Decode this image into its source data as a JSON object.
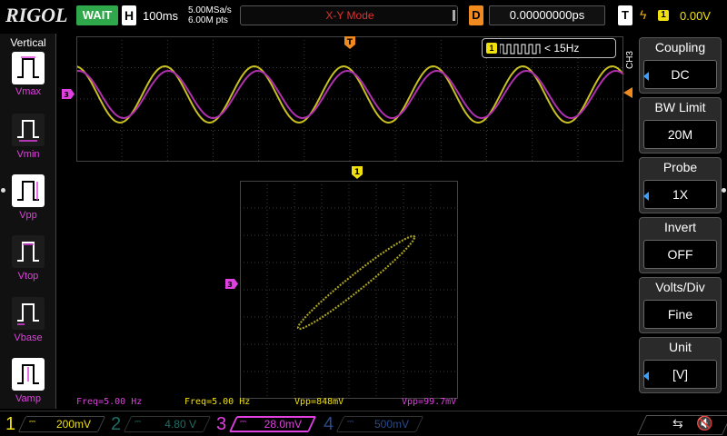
{
  "topbar": {
    "brand": "RIGOL",
    "run_status": "WAIT",
    "horizontal_label": "H",
    "timebase": "100ms",
    "sample_rate": "5.00MSa/s",
    "memory_depth": "6.00M pts",
    "mode_title": "X-Y Mode",
    "delay_label": "D",
    "delay_value": "0.00000000ps",
    "trigger_label": "T",
    "trigger_source": "1",
    "trigger_level": "0.00V"
  },
  "left_menu": {
    "title": "Vertical",
    "items": [
      {
        "label": "Vmax",
        "icon": "vmax-icon"
      },
      {
        "label": "Vmin",
        "icon": "vmin-icon"
      },
      {
        "label": "Vpp",
        "icon": "vpp-icon"
      },
      {
        "label": "Vtop",
        "icon": "vtop-icon"
      },
      {
        "label": "Vbase",
        "icon": "vbase-icon"
      },
      {
        "label": "Vamp",
        "icon": "vamp-icon"
      }
    ]
  },
  "display": {
    "trigger_marker": "T",
    "ch1_marker": "1",
    "ch3_marker": "3",
    "ch3_marker_xy": "3",
    "freq_badge": {
      "channel": "1",
      "text": "< 15Hz"
    },
    "measurements": [
      {
        "text": "Freq=5.00 Hz",
        "color": "#e040e0"
      },
      {
        "text": "Freq=5.00 Hz",
        "color": "#f0e010"
      },
      {
        "text": "Vpp=848mV",
        "color": "#f0e010"
      },
      {
        "text": "Vpp=99.7mV",
        "color": "#e040e0"
      }
    ],
    "ch3_side_label": "CH3"
  },
  "right_menu": {
    "items": [
      {
        "header": "Coupling",
        "value": "DC",
        "arrow": true
      },
      {
        "header": "BW Limit",
        "value": "20M",
        "arrow": false
      },
      {
        "header": "Probe",
        "value": "1X",
        "arrow": true
      },
      {
        "header": "Invert",
        "value": "OFF",
        "arrow": false
      },
      {
        "header": "Volts/Div",
        "value": "Fine",
        "arrow": false
      },
      {
        "header": "Unit",
        "value": "[V]",
        "arrow": true
      }
    ]
  },
  "channels": [
    {
      "num": "1",
      "scale": "200mV",
      "color": "#f0e010",
      "active": false
    },
    {
      "num": "2",
      "scale": "4.80 V",
      "color": "#1e6e66",
      "active": false
    },
    {
      "num": "3",
      "scale": "28.0mV",
      "color": "#e040e0",
      "active": true
    },
    {
      "num": "4",
      "scale": "500mV",
      "color": "#2a4a8a",
      "active": false
    }
  ],
  "colors": {
    "ch1": "#f0e010",
    "ch3": "#e040e0",
    "grid": "#3a3a3a",
    "wait": "#2ea84a",
    "delay": "#f08a1e"
  }
}
